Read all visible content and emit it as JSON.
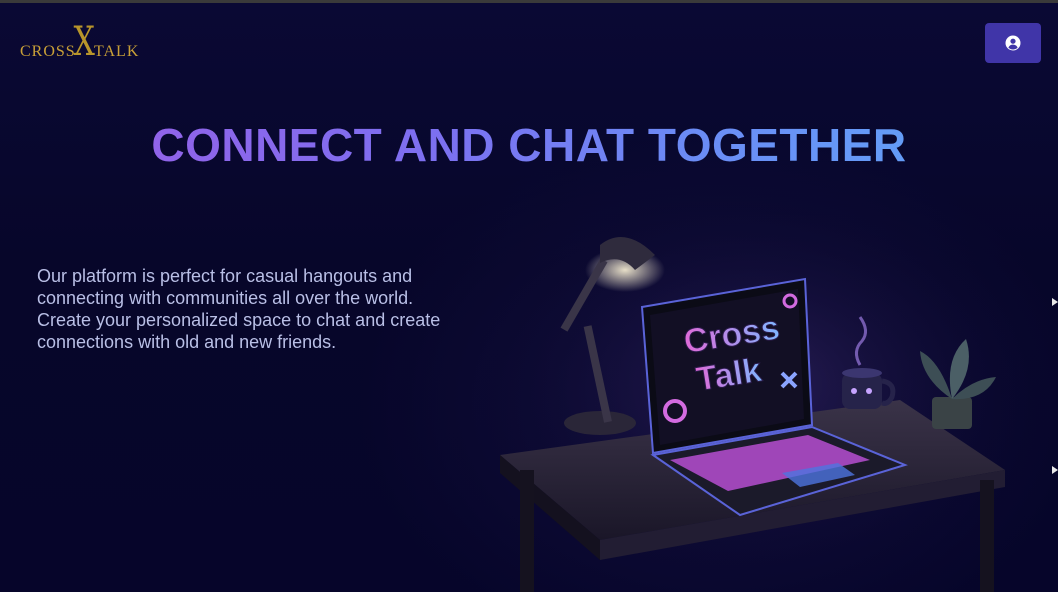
{
  "header": {
    "logo": {
      "mark": "X",
      "left_text": "CROSS",
      "right_text": "TALK"
    },
    "profile_button": {
      "icon": "user-circle-icon"
    }
  },
  "hero": {
    "title": "CONNECT AND CHAT TOGETHER",
    "description": "Our platform is perfect for casual hangouts and connecting with communities all over the world. Create your personalized space to chat and create connections with old and new friends."
  },
  "illustration": {
    "screen_line1": "Cross",
    "screen_line2": "Talk"
  },
  "colors": {
    "background": "#07062a",
    "accent_button": "#4035a8",
    "logo_gold": "#c9a037",
    "title_gradient_start": "#9b5de5",
    "title_gradient_end": "#5fa8f9",
    "body_text": "#b9bfe6"
  }
}
